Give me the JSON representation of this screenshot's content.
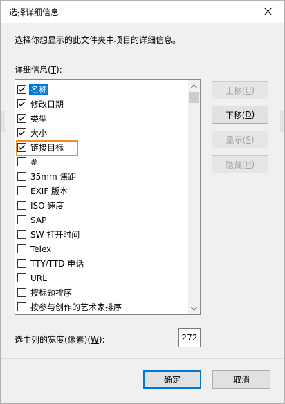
{
  "dialog": {
    "title": "选择详细信息",
    "description": "选择你想显示的此文件夹中项目的详细信息。",
    "details_label_prefix": "详细信息(",
    "details_label_key": "T",
    "details_label_suffix": "):"
  },
  "items": [
    {
      "label": "名称",
      "checked": true,
      "selected": true
    },
    {
      "label": "修改日期",
      "checked": true
    },
    {
      "label": "类型",
      "checked": true
    },
    {
      "label": "大小",
      "checked": true
    },
    {
      "label": "链接目标",
      "checked": true
    },
    {
      "label": "#",
      "checked": false
    },
    {
      "label": "35mm 焦距",
      "checked": false
    },
    {
      "label": "EXIF 版本",
      "checked": false
    },
    {
      "label": "ISO 速度",
      "checked": false
    },
    {
      "label": "SAP",
      "checked": false
    },
    {
      "label": "SW 打开时间",
      "checked": false
    },
    {
      "label": "Telex",
      "checked": false
    },
    {
      "label": "TTY/TTD 电话",
      "checked": false
    },
    {
      "label": "URL",
      "checked": false
    },
    {
      "label": "按标题排序",
      "checked": false
    },
    {
      "label": "按参与创作的艺术家排序",
      "checked": false
    }
  ],
  "buttons": {
    "move_up": {
      "text": "上移(",
      "key": "U",
      "end": ")"
    },
    "move_down": {
      "text": "下移(",
      "key": "D",
      "end": ")"
    },
    "show": {
      "text": "显示(",
      "key": "S",
      "end": ")"
    },
    "hide": {
      "text": "隐藏(",
      "key": "H",
      "end": ")"
    },
    "ok": "确定",
    "cancel": "取消"
  },
  "width": {
    "label_prefix": "选中列的宽度(像素)(",
    "label_key": "W",
    "label_suffix": "):",
    "value": "272"
  },
  "colors": {
    "selection": "#0078d7",
    "highlight": "#f28c28"
  }
}
